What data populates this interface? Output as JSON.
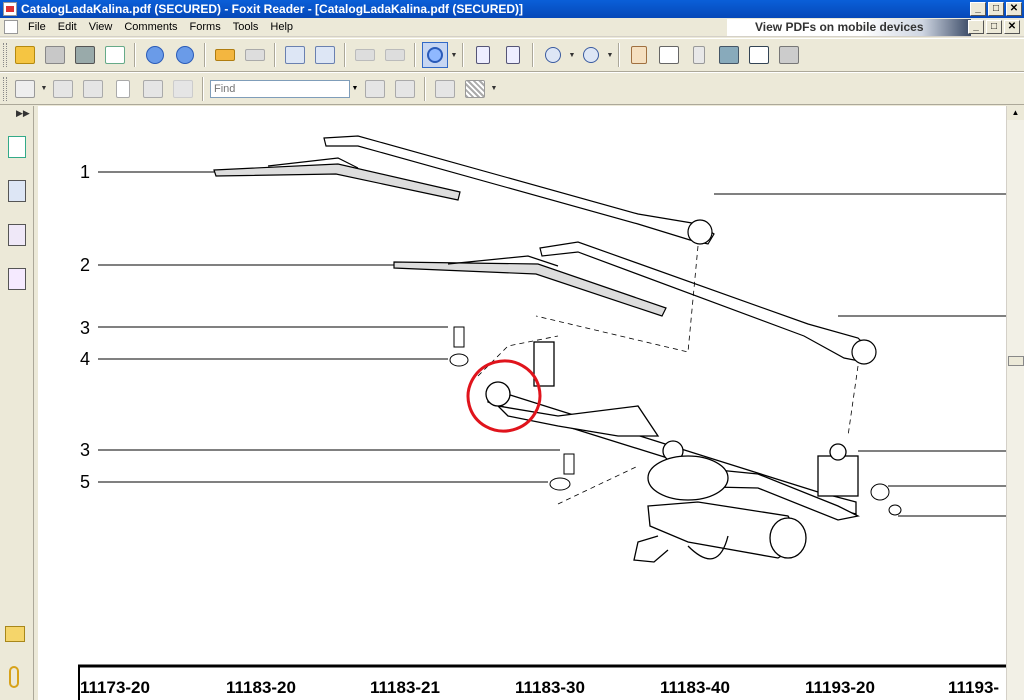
{
  "window": {
    "title": "CatalogLadaKalina.pdf (SECURED) - Foxit Reader - [CatalogLadaKalina.pdf (SECURED)]",
    "btn_min": "_",
    "btn_max": "□",
    "btn_close": "✕"
  },
  "menu": {
    "items": [
      "File",
      "Edit",
      "View",
      "Comments",
      "Forms",
      "Tools",
      "Help"
    ]
  },
  "ad": {
    "text": "View PDFs on mobile devices"
  },
  "toolbar": {
    "find_placeholder": "Find"
  },
  "diagram": {
    "part_numbers": [
      "1",
      "2",
      "3",
      "4",
      "3",
      "5"
    ],
    "codes": [
      "11173-20",
      "11183-20",
      "11183-21",
      "11183-30",
      "11183-40",
      "11193-20",
      "11193-"
    ]
  },
  "colors": {
    "titlebar": "#0a5fd8",
    "annotation_circle": "#e0141c"
  }
}
